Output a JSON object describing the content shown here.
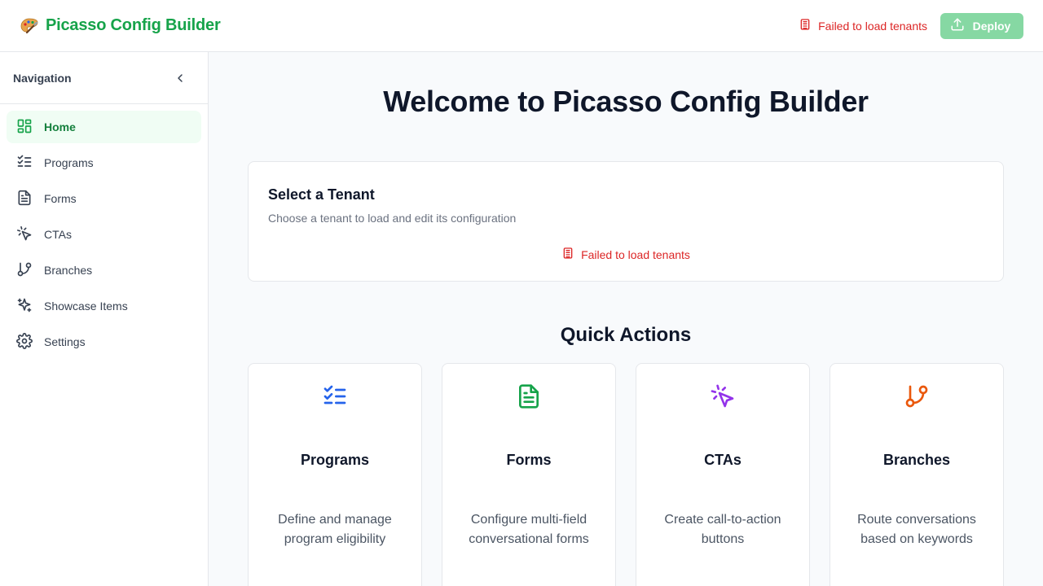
{
  "app": {
    "title": "Picasso Config Builder"
  },
  "header": {
    "error_text": "Failed to load tenants",
    "deploy_label": "Deploy"
  },
  "sidebar": {
    "title": "Navigation",
    "items": [
      {
        "label": "Home",
        "icon": "layout-dashboard-icon",
        "active": true
      },
      {
        "label": "Programs",
        "icon": "list-checks-icon"
      },
      {
        "label": "Forms",
        "icon": "file-text-icon"
      },
      {
        "label": "CTAs",
        "icon": "mouse-pointer-click-icon"
      },
      {
        "label": "Branches",
        "icon": "git-branch-icon"
      },
      {
        "label": "Showcase Items",
        "icon": "sparkles-icon"
      },
      {
        "label": "Settings",
        "icon": "settings-icon"
      }
    ]
  },
  "main": {
    "welcome": "Welcome to Picasso Config Builder",
    "tenant": {
      "title": "Select a Tenant",
      "subtitle": "Choose a tenant to load and edit its configuration",
      "error": "Failed to load tenants"
    },
    "quick_actions": {
      "title": "Quick Actions",
      "cards": [
        {
          "name": "Programs",
          "description": "Define and manage program eligibility",
          "icon": "list-checks-icon",
          "color": "#2563eb"
        },
        {
          "name": "Forms",
          "description": "Configure multi-field conversational forms",
          "icon": "file-text-icon",
          "color": "#16a34a"
        },
        {
          "name": "CTAs",
          "description": "Create call-to-action buttons",
          "icon": "mouse-pointer-click-icon",
          "color": "#9333ea"
        },
        {
          "name": "Branches",
          "description": "Route conversations based on keywords",
          "icon": "git-branch-icon",
          "color": "#ea580c"
        }
      ]
    }
  },
  "colors": {
    "brand": "#16a34a",
    "error": "#dc2626",
    "deploy_disabled": "#86d8a3"
  }
}
